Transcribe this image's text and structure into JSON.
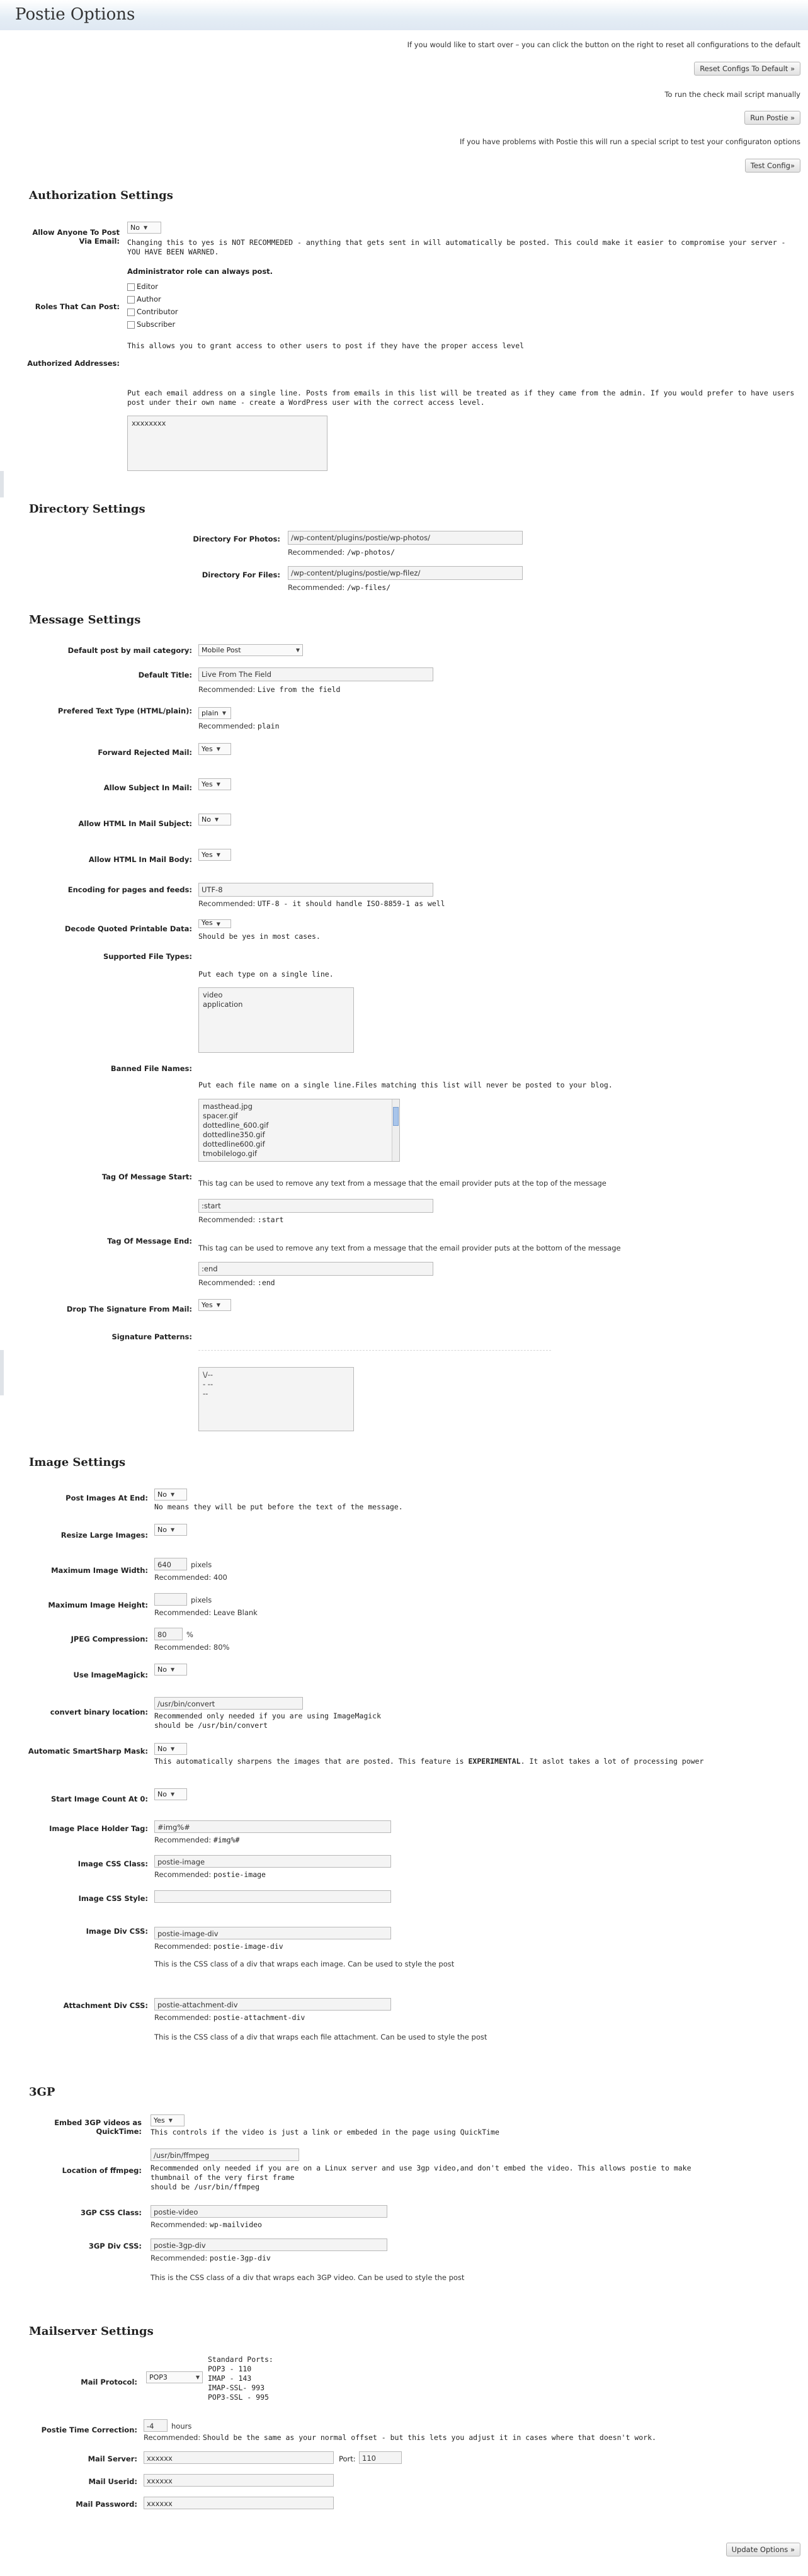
{
  "page": {
    "title": "Postie Options"
  },
  "top": {
    "reset_text": "If you would like to start over – you can click the button on the right to reset all configurations to the default",
    "reset_button": "Reset Configs To Default »",
    "run_text": "To run the check mail script manually",
    "run_button": "Run Postie »",
    "test_text": "If you have problems with Postie this will run a special script to test your configuraton options",
    "test_button": "Test Config»"
  },
  "auth": {
    "heading": "Authorization Settings",
    "allow_anyone_label": "Allow Anyone To Post Via Email:",
    "allow_anyone_value": "No",
    "allow_anyone_help": "Changing this to yes is NOT RECOMMEDED - anything that gets sent in will automatically be posted. This could make it easier to compromise your server - YOU HAVE BEEN WARNED.",
    "roles_label": "Roles That Can Post:",
    "admin_note": "Administrator role can always post.",
    "roles": [
      "Editor",
      "Author",
      "Contributor",
      "Subscriber"
    ],
    "roles_help": "This allows you to grant access to other users to post if they have the proper access level",
    "addresses_label": "Authorized Addresses:",
    "addresses_help": "Put each email address on a single line. Posts from emails in this list will be treated as if they came from the admin. If you would prefer to have users post under their own name - create a WordPress user with the correct access level.",
    "addresses_value": "xxxxxxxx"
  },
  "dir": {
    "heading": "Directory Settings",
    "photos_label": "Directory For Photos:",
    "photos_value": "/wp-content/plugins/postie/wp-photos/",
    "photos_rec_prefix": "Recommended:",
    "photos_rec": "/wp-photos/",
    "files_label": "Directory For Files:",
    "files_value": "/wp-content/plugins/postie/wp-filez/",
    "files_rec_prefix": "Recommended:",
    "files_rec": "/wp-files/"
  },
  "msg": {
    "heading": "Message Settings",
    "category_label": "Default post by mail category:",
    "category_value": "Mobile Post",
    "title_label": "Default Title:",
    "title_value": "Live From The Field",
    "title_rec_prefix": "Recommended:",
    "title_rec": "Live from the field",
    "texttype_label": "Prefered Text Type (HTML/plain):",
    "texttype_value": "plain",
    "texttype_rec_prefix": "Recommended:",
    "texttype_rec": "plain",
    "forward_label": "Forward Rejected Mail:",
    "forward_value": "Yes",
    "subject_label": "Allow Subject In Mail:",
    "subject_value": "Yes",
    "htmlsubject_label": "Allow HTML In Mail Subject:",
    "htmlsubject_value": "No",
    "htmlbody_label": "Allow HTML In Mail Body:",
    "htmlbody_value": "Yes",
    "encoding_label": "Encoding for pages and feeds:",
    "encoding_value": "UTF-8",
    "encoding_rec_prefix": "Recommended:",
    "encoding_rec": "UTF-8 - it should handle ISO-8859-1 as well",
    "decode_label": "Decode Quoted Printable Data:",
    "decode_value": "Yes",
    "decode_help": "Should be yes in most cases.",
    "filetypes_label": "Supported File Types:",
    "filetypes_help": "Put each type on a single line.",
    "filetypes": [
      "video",
      "application"
    ],
    "banned_label": "Banned File Names:",
    "banned_help": "Put each file name on a single line.Files matching this list will never be posted to your blog.",
    "banned": [
      "masthead.jpg",
      "spacer.gif",
      "dottedline_600.gif",
      "dottedline350.gif",
      "dottedline600.gif",
      "tmobilelogo.gif"
    ],
    "tagstart_label": "Tag Of Message Start:",
    "tagstart_help": "This tag can be used to remove any text from a message that the email provider puts at the top of the message",
    "tagstart_value": ":start",
    "tagstart_rec_prefix": "Recommended:",
    "tagstart_rec": ":start",
    "tagend_label": "Tag Of Message End:",
    "tagend_help": "This tag can be used to remove any text from a message that the email provider puts at the bottom of the message",
    "tagend_value": ":end",
    "tagend_rec_prefix": "Recommended:",
    "tagend_rec": ":end",
    "dropsig_label": "Drop The Signature From Mail:",
    "dropsig_value": "Yes",
    "sigpatterns_label": "Signature Patterns:",
    "sigpatterns": [
      "\\/--",
      "- --",
      "--"
    ]
  },
  "img": {
    "heading": "Image Settings",
    "atend_label": "Post Images At End:",
    "atend_value": "No",
    "atend_help": "No means they will be put before the text of the message.",
    "resize_label": "Resize Large Images:",
    "resize_value": "No",
    "maxw_label": "Maximum Image Width:",
    "maxw_value": "640",
    "maxw_unit": "pixels",
    "maxw_rec_prefix": "Recommended:",
    "maxw_rec": "400",
    "maxh_label": "Maximum Image Height:",
    "maxh_value": "",
    "maxh_unit": "pixels",
    "maxh_rec_prefix": "Recommended:",
    "maxh_rec": "Leave Blank",
    "jpeg_label": "JPEG Compression:",
    "jpeg_value": "80",
    "jpeg_unit": "%",
    "jpeg_rec_prefix": "Recommended:",
    "jpeg_rec": "80%",
    "magick_label": "Use ImageMagick:",
    "magick_value": "No",
    "convert_label": "convert binary location:",
    "convert_value": "/usr/bin/convert",
    "convert_help1": "Recommended only needed if you are using ImageMagick",
    "convert_help2": "should be /usr/bin/convert",
    "smartsharp_label": "Automatic SmartSharp Mask:",
    "smartsharp_value": "No",
    "smartsharp_help_a": "This automatically sharpens the images that are posted. This feature is ",
    "smartsharp_help_b": "EXPERIMENTAL",
    "smartsharp_help_c": ". It aslot takes a lot of processing power",
    "startcount_label": "Start Image Count At 0:",
    "startcount_value": "No",
    "placeholder_label": "Image Place Holder Tag:",
    "placeholder_value": "#img%#",
    "placeholder_rec_prefix": "Recommended:",
    "placeholder_rec": "#img%#",
    "cssclass_label": "Image CSS Class:",
    "cssclass_value": "postie-image",
    "cssclass_rec_prefix": "Recommended:",
    "cssclass_rec": "postie-image",
    "cssstyle_label": "Image CSS Style:",
    "cssstyle_value": "",
    "divcss_label": "Image Div CSS:",
    "divcss_value": "postie-image-div",
    "divcss_rec_prefix": "Recommended:",
    "divcss_rec": "postie-image-div",
    "divcss_help": "This is the CSS class of a div that wraps each image. Can be used to style the post",
    "attdiv_label": "Attachment Div CSS:",
    "attdiv_value": "postie-attachment-div",
    "attdiv_rec_prefix": "Recommended:",
    "attdiv_rec": "postie-attachment-div",
    "attdiv_help": "This is the CSS class of a div that wraps each file attachment. Can be used to style the post"
  },
  "gp": {
    "heading": "3GP",
    "embed_label": "Embed 3GP videos as QuickTime:",
    "embed_value": "Yes",
    "embed_help": "This controls if the video is just a link or embeded in the page using QuickTime",
    "ffmpeg_label": "Location of ffmpeg:",
    "ffmpeg_value": "/usr/bin/ffmpeg",
    "ffmpeg_help1": "Recommended only needed if you are on a Linux server and use 3gp video,and don't embed the video. This allows postie to make",
    "ffmpeg_help2": "thumbnail of the very first frame",
    "ffmpeg_help3": "should be /usr/bin/ffmpeg",
    "css_label": "3GP CSS Class:",
    "css_value": "postie-video",
    "css_rec_prefix": "Recommended:",
    "css_rec": "wp-mailvideo",
    "div_label": "3GP Div CSS:",
    "div_value": "postie-3gp-div",
    "div_rec_prefix": "Recommended:",
    "div_rec": "postie-3gp-div",
    "div_help": "This is the CSS class of a div that wraps each 3GP video. Can be used to style the post"
  },
  "mail": {
    "heading": "Mailserver Settings",
    "protocol_label": "Mail Protocol:",
    "protocol_value": "POP3",
    "ports": [
      "Standard Ports:",
      "POP3 - 110",
      "IMAP - 143",
      "IMAP-SSL- 993",
      "POP3-SSL - 995"
    ],
    "tz_label": "Postie Time Correction:",
    "tz_value": "-4",
    "tz_unit": "hours",
    "tz_rec_prefix": "Recommended:",
    "tz_rec": "Should be the same as your normal offset - but this lets you adjust it in cases where that doesn't work.",
    "server_label": "Mail Server:",
    "server_value": "xxxxxx",
    "port_label": "Port:",
    "port_value": "110",
    "userid_label": "Mail Userid:",
    "userid_value": "xxxxxx",
    "password_label": "Mail Password:",
    "password_value": "xxxxxx",
    "update_button": "Update Options »"
  },
  "colors": {
    "header_gradient_end": "#dfe8f2",
    "divider": "#dfe3e8",
    "input_bg": "#f4f4f4",
    "input_border": "#b8b8b8"
  }
}
